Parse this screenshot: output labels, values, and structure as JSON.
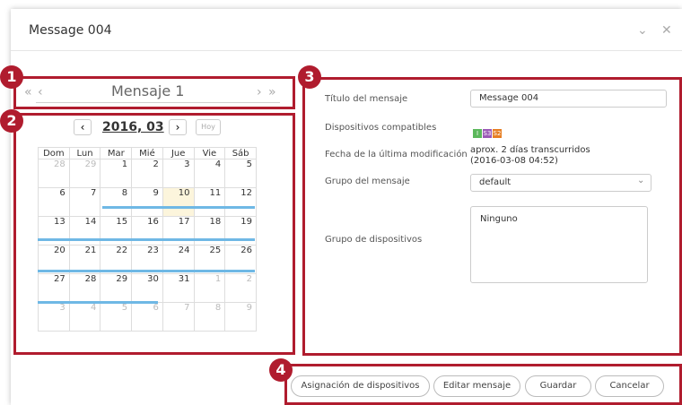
{
  "dialog": {
    "title": "Message 004",
    "minimize_icon": "chevron-down-icon",
    "close_icon": "close-icon"
  },
  "callouts": [
    "1",
    "2",
    "3",
    "4"
  ],
  "message_nav": {
    "prev_all": "«",
    "prev": "‹",
    "title": "Mensaje 1",
    "next": "›",
    "next_all": "»"
  },
  "calendar": {
    "prev": "‹",
    "year_month": "2016, 03",
    "next": "›",
    "today": "Hoy",
    "weekdays": [
      "Dom",
      "Lun",
      "Mar",
      "Mié",
      "Jue",
      "Vie",
      "Sáb"
    ],
    "weeks": [
      [
        "28",
        "29",
        "1",
        "2",
        "3",
        "4",
        "5"
      ],
      [
        "6",
        "7",
        "8",
        "9",
        "10",
        "11",
        "12"
      ],
      [
        "13",
        "14",
        "15",
        "16",
        "17",
        "18",
        "19"
      ],
      [
        "20",
        "21",
        "22",
        "23",
        "24",
        "25",
        "26"
      ],
      [
        "27",
        "28",
        "29",
        "30",
        "31",
        "1",
        "2"
      ],
      [
        "3",
        "4",
        "5",
        "6",
        "7",
        "8",
        "9"
      ]
    ],
    "highlight_color": "#6fb8e5",
    "today_color": "#fcf5dc"
  },
  "properties": {
    "title_label": "Título del mensaje",
    "title_value": "Message 004",
    "devices_label": "Dispositivos compatibles",
    "devices": [
      {
        "text": "I",
        "color": "#5cb85c"
      },
      {
        "text": "S3",
        "color": "#9b59b6"
      },
      {
        "text": "S2",
        "color": "#e67e22"
      }
    ],
    "modified_label": "Fecha de la última modificación",
    "modified_value_1": "aprox. 2 días transcurridos",
    "modified_value_2": "(2016-03-08 04:52)",
    "group_label": "Grupo del mensaje",
    "group_value": "default",
    "device_group_label": "Grupo de dispositivos",
    "device_group_value": "Ninguno"
  },
  "footer": {
    "assign_label": "Asignación de dispositivos",
    "edit_label": "Editar mensaje",
    "save_label": "Guardar",
    "cancel_label": "Cancelar"
  },
  "accent_color": "#b01c2e"
}
